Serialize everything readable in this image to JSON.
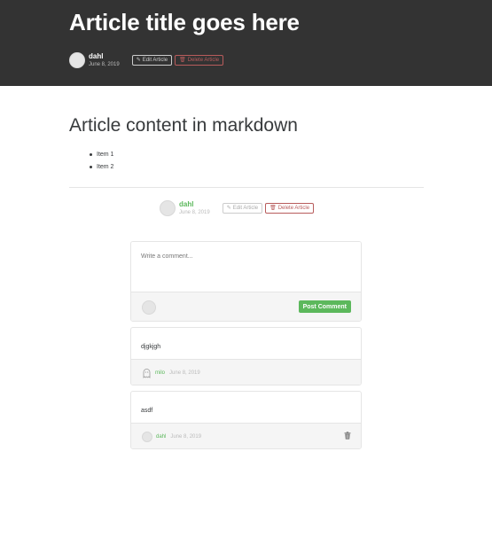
{
  "banner": {
    "title": "Article title goes here",
    "author": {
      "name": "dahl",
      "date": "June 8, 2019"
    },
    "edit_label": "Edit Article",
    "delete_label": "Delete Article"
  },
  "article": {
    "heading": "Article content in markdown",
    "list": [
      "Item 1",
      "Item 2"
    ]
  },
  "article_actions": {
    "author": {
      "name": "dahl",
      "date": "June 8, 2019"
    },
    "edit_label": "Edit Article",
    "delete_label": "Delete Article"
  },
  "comment_form": {
    "placeholder": "Write a comment...",
    "submit_label": "Post Comment"
  },
  "comments": [
    {
      "body": "djgkjgh",
      "author": "milo",
      "date": "June 8, 2019",
      "deletable": false
    },
    {
      "body": "asdf",
      "author": "dahl",
      "date": "June 8, 2019",
      "deletable": true
    }
  ],
  "colors": {
    "banner_bg": "#333333",
    "accent": "#5cb85c",
    "danger": "#b85c5c"
  },
  "icons": {
    "edit": "pencil-icon",
    "delete": "trash-icon",
    "comment_delete": "trash-icon"
  }
}
